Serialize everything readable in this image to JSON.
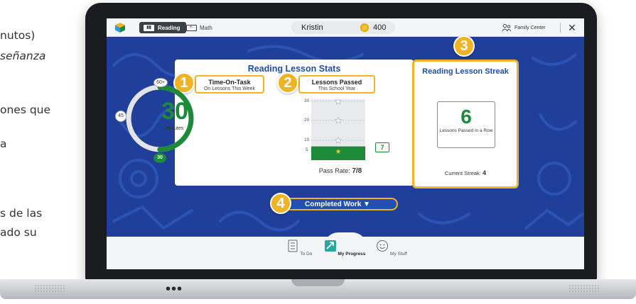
{
  "slide": {
    "fragments": [
      "nutos)",
      "señanza",
      "ones que",
      "a",
      "s de las",
      "ado su"
    ]
  },
  "topbar": {
    "reading_label": "Reading",
    "math_label": "Math",
    "user_name": "Kristin",
    "coin_count": "400",
    "family_label": "Family Center",
    "close_label": "✕"
  },
  "stats": {
    "title": "Reading Lesson Stats",
    "time_title": "Time-On-Task",
    "time_sub": "On Lessons This Week",
    "lessons_title": "Lessons Passed",
    "lessons_sub": "This School Year",
    "minutes_value": "30",
    "minutes_label": "Minutes",
    "tick_top": "60+",
    "tick_left": "45",
    "tick_bottom": "30",
    "goal_fraction": 0.5,
    "axis": [
      "30",
      "20",
      "10",
      "5"
    ],
    "lessons_value": "7",
    "pass_rate_label": "Pass Rate:",
    "pass_rate_value": "7/8"
  },
  "streak": {
    "title": "Reading Lesson Streak",
    "value": "6",
    "label": "Lessons Passed in a Row",
    "current_label": "Current Streak:",
    "current_value": "4"
  },
  "badges": [
    "1",
    "2",
    "3",
    "4"
  ],
  "completed_work_label": "Completed Work ▼",
  "nav": {
    "todo": "To Do",
    "progress": "My Progress",
    "stuff": "My Stuff"
  },
  "colors": {
    "accent": "#f0b323",
    "brand_blue": "#1f4ea8",
    "green": "#1d8a3a",
    "background_blue": "#1f3f9a"
  }
}
